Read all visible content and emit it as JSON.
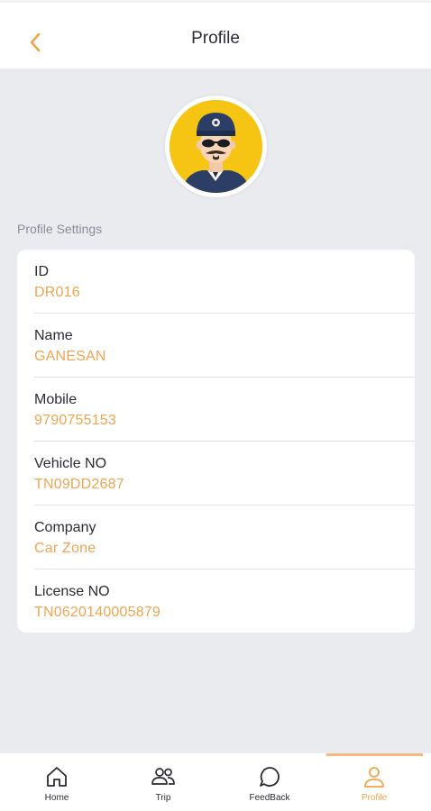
{
  "header": {
    "title": "Profile",
    "back_icon": "chevron-left-icon"
  },
  "avatar": {
    "icon": "driver-avatar",
    "bg_color": "#f6c412"
  },
  "section_label": "Profile Settings",
  "profile_fields": [
    {
      "label": "ID",
      "value": "DR016"
    },
    {
      "label": "Name",
      "value": "GANESAN"
    },
    {
      "label": "Mobile",
      "value": "9790755153"
    },
    {
      "label": "Vehicle NO",
      "value": "TN09DD2687"
    },
    {
      "label": "Company",
      "value": "Car Zone"
    },
    {
      "label": "License NO",
      "value": "TN0620140005879"
    }
  ],
  "bottom_nav": {
    "items": [
      {
        "label": "Home",
        "icon": "home-icon"
      },
      {
        "label": "Trip",
        "icon": "users-icon"
      },
      {
        "label": "FeedBack",
        "icon": "chat-bubble-icon"
      },
      {
        "label": "Profile",
        "icon": "user-icon"
      }
    ],
    "active": "Profile"
  },
  "colors": {
    "accent": "#efa450",
    "background": "#e9ebef",
    "card": "#ffffff"
  }
}
